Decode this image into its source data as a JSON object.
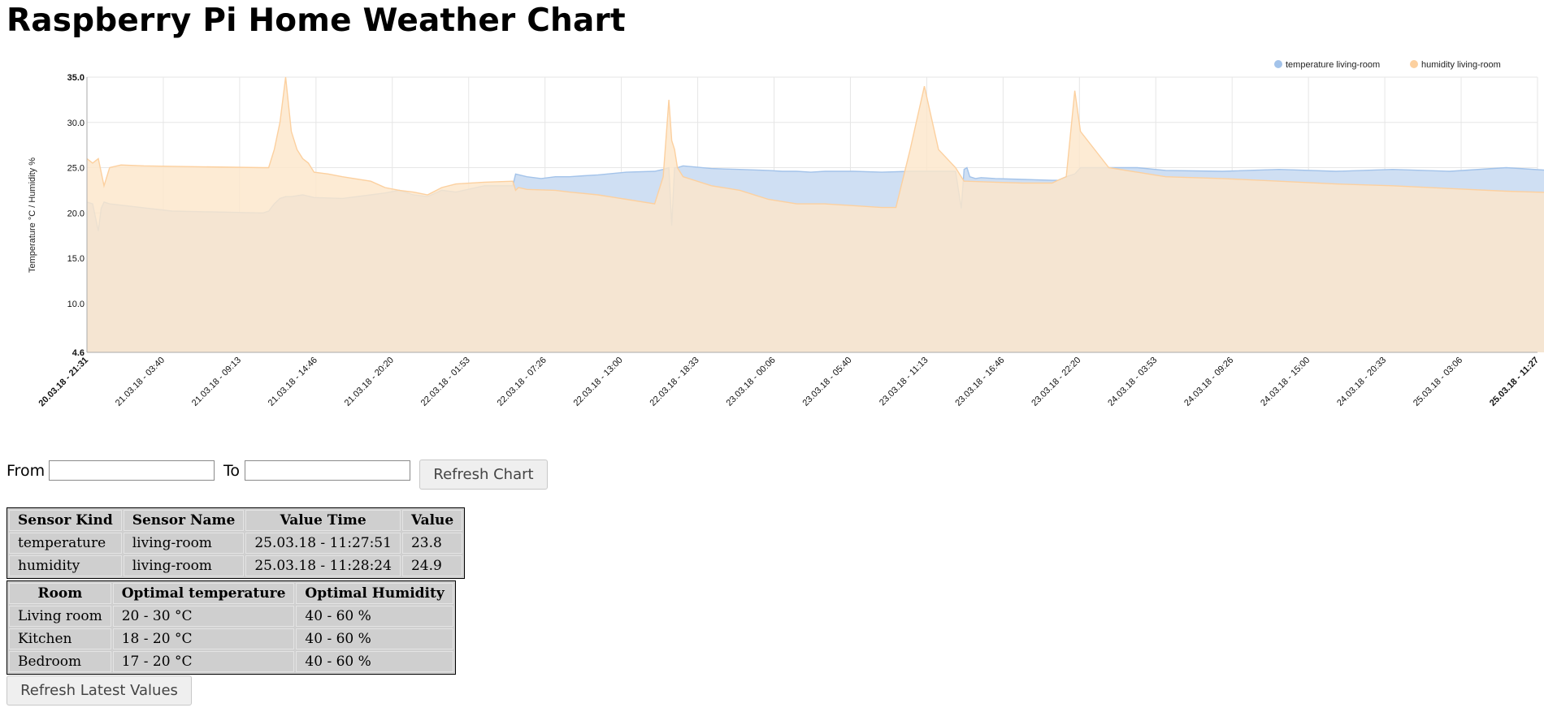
{
  "page": {
    "title": "Raspberry Pi Home Weather Chart"
  },
  "chart_data": {
    "type": "area",
    "ylabel": "Temperature °C / Humidity %",
    "ylim": [
      4.6,
      35.0
    ],
    "ytick_labels": [
      "35.0",
      "30.0",
      "25.0",
      "20.0",
      "15.0",
      "10.0",
      "4.6"
    ],
    "yticks": [
      35.0,
      30.0,
      25.0,
      20.0,
      15.0,
      10.0,
      4.6
    ],
    "xlim": [
      0,
      5110
    ],
    "xtick_labels": [
      "20.03.18 - 21:31",
      "21.03.18 - 03:40",
      "21.03.18 - 09:13",
      "21.03.18 - 14:46",
      "21.03.18 - 20:20",
      "22.03.18 - 01:53",
      "22.03.18 - 07:26",
      "22.03.18 - 13:00",
      "22.03.18 - 18:33",
      "23.03.18 - 00:06",
      "23.03.18 - 05:40",
      "23.03.18 - 11:13",
      "23.03.18 - 16:46",
      "23.03.18 - 22:20",
      "24.03.18 - 03:53",
      "24.03.18 - 09:26",
      "24.03.18 - 15:00",
      "24.03.18 - 20:33",
      "25.03.18 - 03:06",
      "25.03.18 - 11:27"
    ],
    "xtick_minutes": [
      0,
      369,
      702,
      1035,
      1369,
      1702,
      2035,
      2369,
      2702,
      3035,
      3369,
      3702,
      4035,
      4369,
      4702,
      5035,
      5369,
      5702,
      6095,
      6596
    ],
    "legend_position": "top-right",
    "grid": true,
    "series": [
      {
        "name": "temperature living-room",
        "color": "#a3c3ea",
        "fill": "#cfdff3",
        "x": [
          0,
          20,
          30,
          40,
          50,
          60,
          80,
          300,
          620,
          640,
          660,
          680,
          700,
          720,
          760,
          800,
          900,
          1000,
          1050,
          1100,
          1150,
          1200,
          1250,
          1300,
          1400,
          1500,
          1510,
          1550,
          1600,
          1650,
          1700,
          1750,
          1800,
          1900,
          2000,
          2030,
          2050,
          2060,
          2070,
          2080,
          2100,
          2200,
          2300,
          2400,
          2450,
          2500,
          2550,
          2600,
          2700,
          2800,
          2900,
          3000,
          3060,
          3080,
          3090,
          3100,
          3110,
          3130,
          3150,
          3200,
          3300,
          3400,
          3420,
          3450,
          3480,
          3500,
          3600,
          3700,
          3800,
          4000,
          4200,
          4400,
          4600,
          4800,
          5000,
          5200,
          5400,
          5600,
          5800,
          6000,
          6050,
          6100,
          6150,
          6200,
          6300,
          6350,
          6400,
          6450,
          6500,
          6596
        ],
        "y": [
          21.2,
          21.0,
          19.5,
          18.0,
          20.5,
          21.2,
          21.0,
          20.2,
          20.0,
          20.2,
          21.0,
          21.6,
          21.8,
          21.8,
          22.0,
          21.7,
          21.6,
          22.0,
          22.2,
          22.5,
          22.0,
          21.8,
          22.5,
          22.3,
          23.0,
          23.0,
          24.3,
          24.0,
          23.8,
          24.0,
          24.0,
          24.1,
          24.2,
          24.5,
          24.6,
          24.8,
          25.0,
          18.6,
          25.0,
          25.0,
          25.2,
          24.9,
          24.8,
          24.7,
          24.6,
          24.6,
          24.5,
          24.6,
          24.6,
          24.5,
          24.6,
          24.6,
          24.6,
          20.5,
          24.8,
          25.0,
          24.0,
          23.8,
          23.9,
          23.8,
          23.7,
          23.6,
          23.6,
          24.0,
          24.3,
          25.0,
          25.0,
          25.0,
          24.7,
          24.6,
          24.8,
          24.6,
          24.8,
          24.6,
          25.0,
          24.6,
          24.8,
          24.8,
          24.6,
          25.0,
          25.2,
          25.0,
          25.0,
          25.0,
          24.8,
          24.6,
          23.8,
          23.8,
          23.6,
          23.5
        ]
      },
      {
        "name": "humidity living-room",
        "color": "#fcd09f",
        "fill": "#fde6cb",
        "x": [
          0,
          20,
          40,
          60,
          80,
          120,
          200,
          400,
          620,
          640,
          660,
          680,
          700,
          720,
          740,
          760,
          780,
          800,
          850,
          900,
          1000,
          1050,
          1100,
          1150,
          1200,
          1250,
          1300,
          1400,
          1500,
          1510,
          1520,
          1550,
          1650,
          1700,
          1800,
          1900,
          2000,
          2030,
          2050,
          2060,
          2070,
          2080,
          2090,
          2100,
          2200,
          2300,
          2400,
          2500,
          2600,
          2700,
          2800,
          2850,
          2900,
          2950,
          3000,
          3060,
          3080,
          3090,
          3100,
          3200,
          3300,
          3400,
          3420,
          3450,
          3480,
          3500,
          3600,
          3700,
          3800,
          4000,
          4200,
          4400,
          4600,
          4800,
          5000,
          5200,
          5400,
          5600,
          5700,
          5800,
          5900,
          6000,
          6050,
          6070,
          6080,
          6090,
          6100,
          6150,
          6200,
          6250,
          6300,
          6350,
          6400,
          6450,
          6500,
          6596
        ],
        "y": [
          26.0,
          25.5,
          26.0,
          23.0,
          25.0,
          25.3,
          25.2,
          25.1,
          25.0,
          25.0,
          27.0,
          30.0,
          35.0,
          29.0,
          27.0,
          26.0,
          25.5,
          24.5,
          24.3,
          24.0,
          23.5,
          22.8,
          22.5,
          22.3,
          22.0,
          22.8,
          23.2,
          23.4,
          23.5,
          22.5,
          22.8,
          22.6,
          22.5,
          22.3,
          22.0,
          21.5,
          21.0,
          24.0,
          32.5,
          28.0,
          27.0,
          25.0,
          24.5,
          24.0,
          23.0,
          22.5,
          21.5,
          21.0,
          21.0,
          20.8,
          20.6,
          20.6,
          27.0,
          34.0,
          27.0,
          25.0,
          24.0,
          23.5,
          23.5,
          23.4,
          23.3,
          23.3,
          23.6,
          24.0,
          33.5,
          29.0,
          25.0,
          24.5,
          24.0,
          23.8,
          23.5,
          23.2,
          23.0,
          22.7,
          22.4,
          22.2,
          21.8,
          21.4,
          21.1,
          21.0,
          20.8,
          21.0,
          21.0,
          24.0,
          31.0,
          29.0,
          25.5,
          25.0,
          24.5,
          24.0,
          23.0,
          23.5,
          23.8,
          23.8,
          24.0,
          25.4
        ]
      }
    ]
  },
  "filter": {
    "from_label": "From",
    "to_label": "To",
    "from_value": "",
    "to_value": "",
    "refresh_chart_label": "Refresh Chart"
  },
  "latest_values": {
    "headers": [
      "Sensor Kind",
      "Sensor Name",
      "Value Time",
      "Value"
    ],
    "rows": [
      [
        "temperature",
        "living-room",
        "25.03.18 - 11:27:51",
        "23.8"
      ],
      [
        "humidity",
        "living-room",
        "25.03.18 - 11:28:24",
        "24.9"
      ]
    ]
  },
  "optimal_values": {
    "headers": [
      "Room",
      "Optimal temperature",
      "Optimal Humidity"
    ],
    "rows": [
      [
        "Living room",
        "20 - 30 °C",
        "40 - 60 %"
      ],
      [
        "Kitchen",
        "18 - 20 °C",
        "40 - 60 %"
      ],
      [
        "Bedroom",
        "17 - 20 °C",
        "40 - 60 %"
      ]
    ]
  },
  "refresh_latest_label": "Refresh Latest Values"
}
